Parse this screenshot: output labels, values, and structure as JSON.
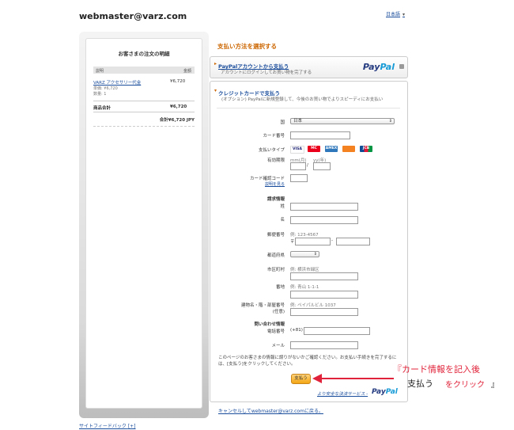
{
  "header": {
    "merchant_email": "webmaster@varz.com",
    "language": "日本語",
    "language_caret": "▾"
  },
  "order": {
    "title": "お客さまの注文の明細",
    "col_desc": "説明",
    "col_amount": "金額",
    "item_name": "VARZ アクセサリー代金",
    "item_unit_price": "単価: ¥6,720",
    "item_qty": "数量: 1",
    "item_amount": "¥6,720",
    "subtotal_label": "商品合計",
    "subtotal_amount": "¥6,720",
    "total": "合計¥6,720 JPY"
  },
  "payment": {
    "section_title": "支払い方法を選択する",
    "paypal_link": "PayPalアカウントから支払う",
    "paypal_sub": "アカウントにログインしてお買い物を完了する",
    "paypal_logo_a": "Pay",
    "paypal_logo_b": "Pal",
    "cc_title": "クレジットカードで支払う",
    "cc_note": "(オプション) PayPalに新規登録して、今後のお買い物でよりスピーディにお支払い"
  },
  "form": {
    "country_label": "国",
    "country_value": "日本",
    "card_number_label": "カード番号",
    "payment_type_label": "支払いタイプ",
    "cards": [
      "VISA",
      "MC",
      "AMEX",
      "",
      "JCB"
    ],
    "expiry_label": "有効期限",
    "expiry_month_hint": "mm(月)",
    "expiry_year_hint": "yy(年)",
    "expiry_sep": "/",
    "cvv_label": "カード確認コード",
    "cvv_help": "説明を見る",
    "billing_header": "請求情報",
    "last_name_label": "姓",
    "first_name_label": "名",
    "postal_label": "郵便番号",
    "postal_hint": "例: 123-4567",
    "postal_prefix": "〒",
    "postal_dash": "-",
    "prefecture_label": "都道府県",
    "city_label": "市区町村",
    "city_hint": "例: 横浜市緑区",
    "street_label": "番地",
    "street_hint": "例: 青山 1-1-1",
    "building_label": "建物名・階・部屋番号",
    "building_optional": "(任意)",
    "building_hint": "例: ペイパルビル 1037",
    "contact_header": "問い合わせ情報",
    "phone_label": "電話番号",
    "phone_prefix": "(+81)",
    "email_label": "メール",
    "confirm_text": "このページのお客さまの情報に誤りがないかご確認ください。お支払い手続きを完了するには、[支払う]をクリックしてください。",
    "pay_button": "支払う",
    "safer_text": "より安全な決済サービス -",
    "safer_logo_a": "Pay",
    "safer_logo_b": "Pal"
  },
  "footer": {
    "cancel_link": "キャンセルしてwebmaster@varz.comに戻る。",
    "feedback_link": "サイトフィードバック",
    "feedback_suffix": "[+]"
  },
  "annotation": {
    "line1": "『カード情報を記入後",
    "line2a": "支払う",
    "line2b": "をクリック",
    "line2c": "』"
  },
  "colors": {
    "accent_orange": "#cc6600",
    "link_blue": "#1a4d9c",
    "annotation_red": "#e0233a"
  }
}
